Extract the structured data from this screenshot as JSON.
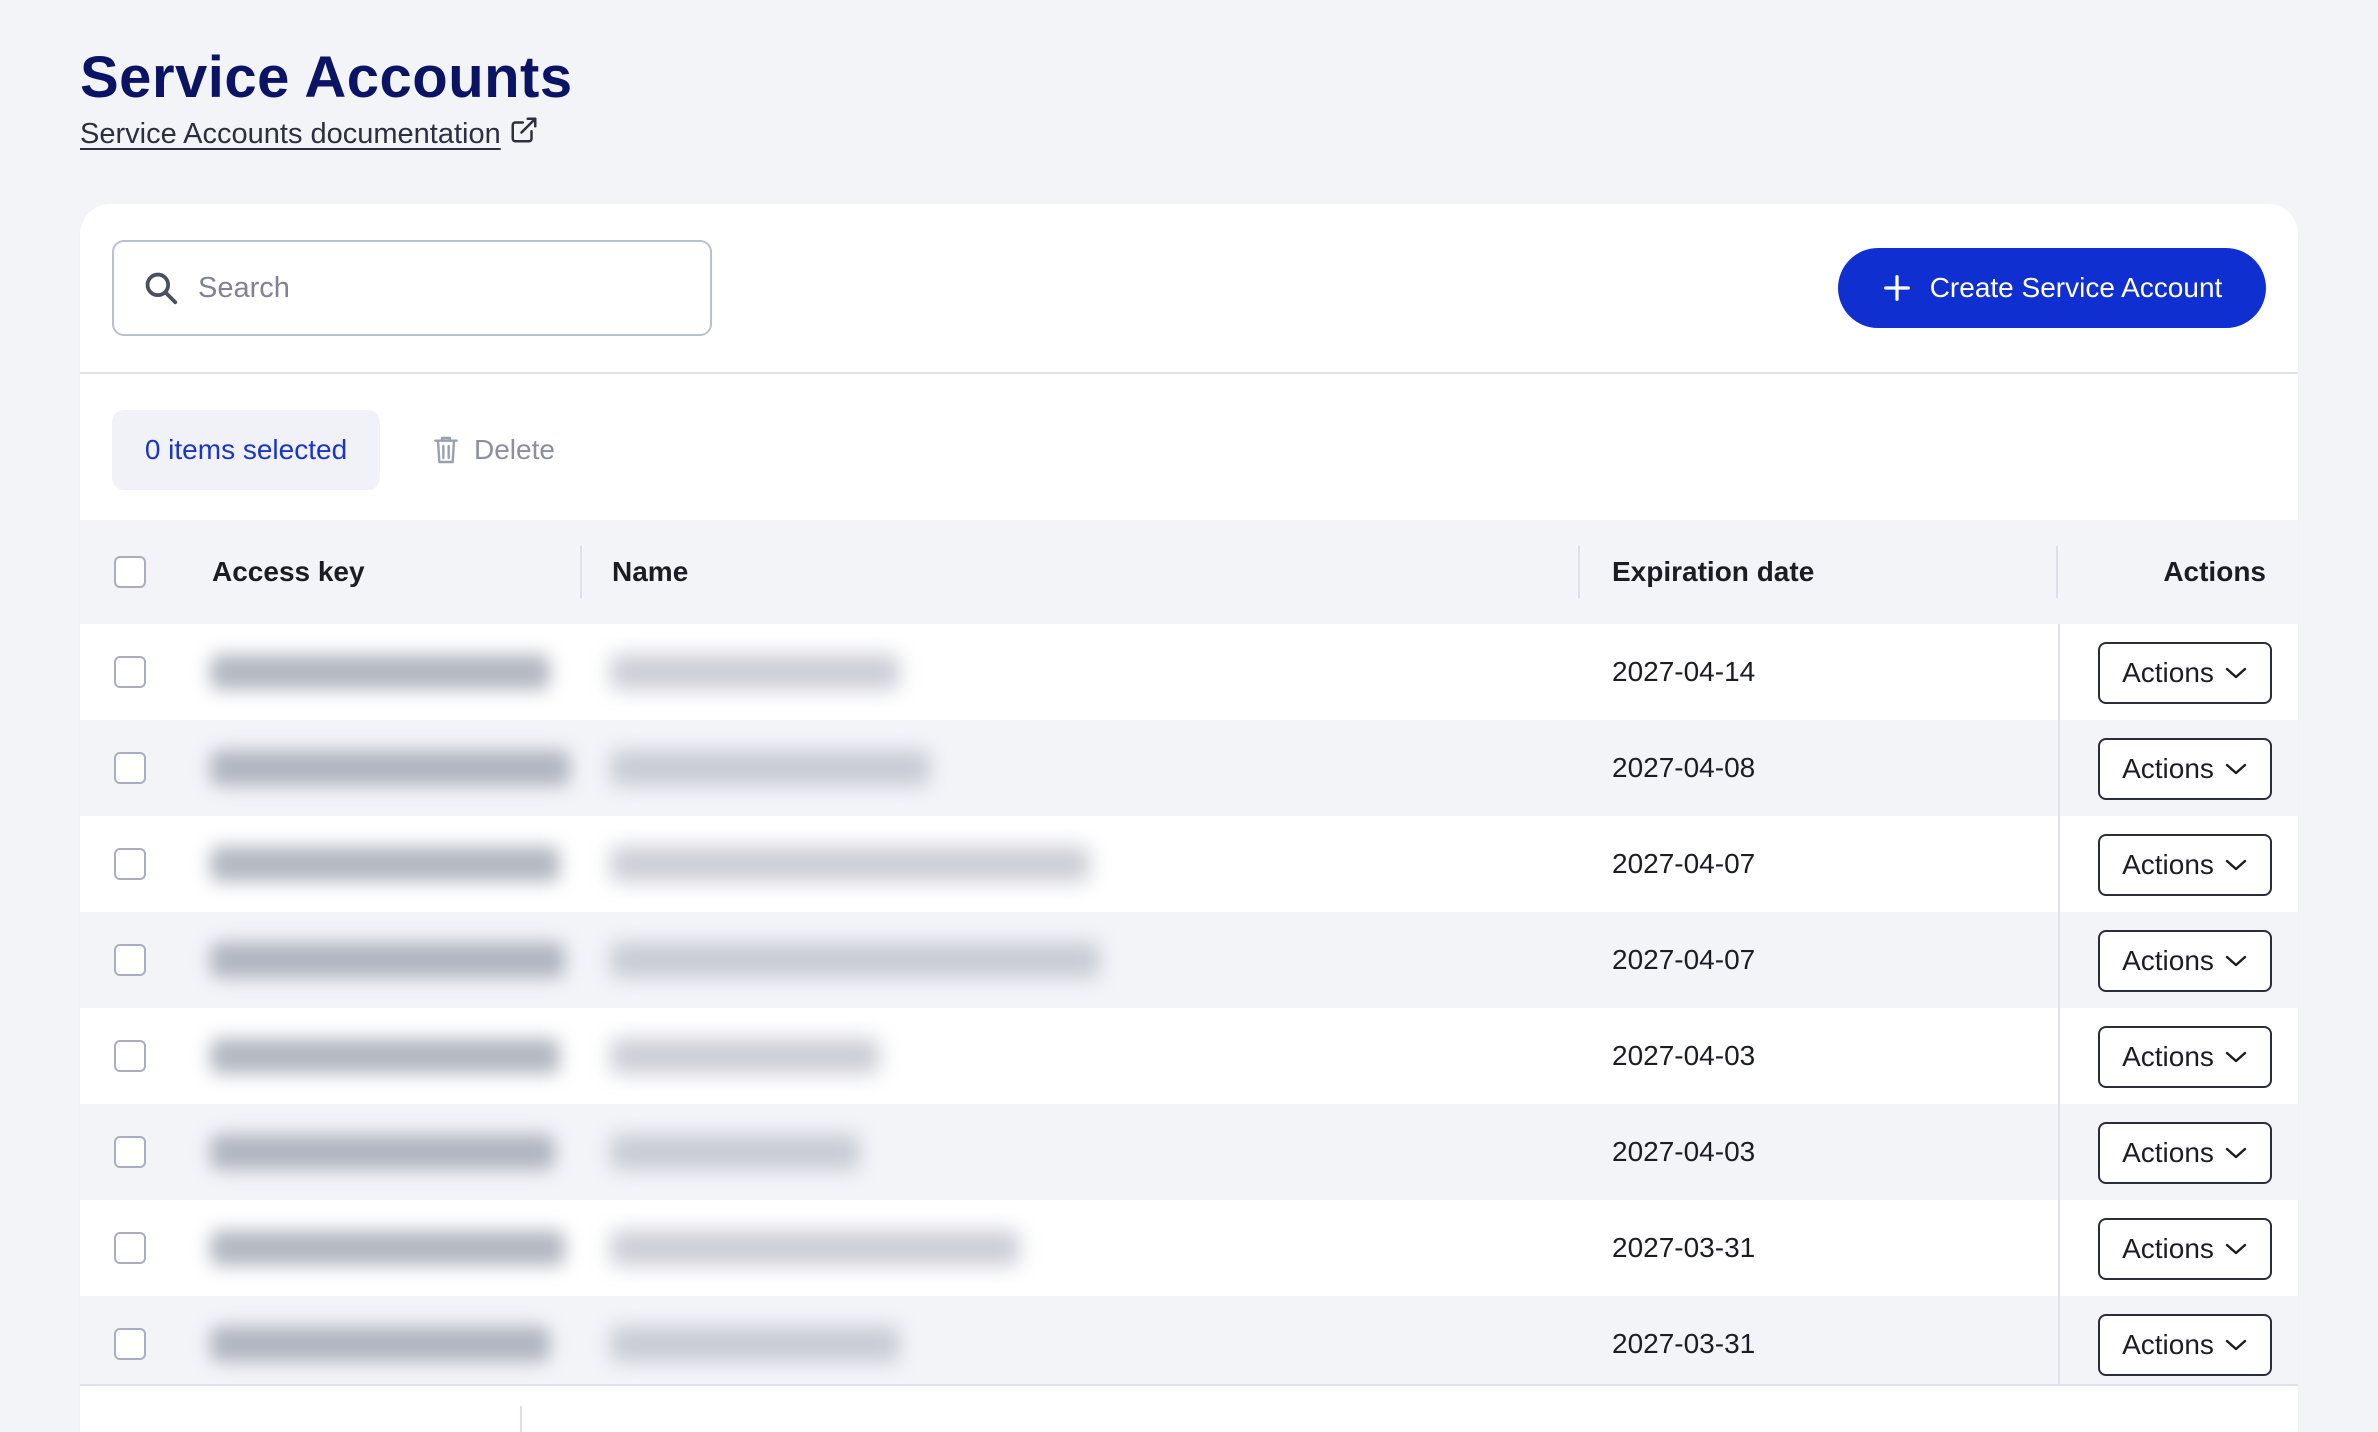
{
  "header": {
    "title": "Service Accounts",
    "doc_link_label": "Service Accounts documentation"
  },
  "toolbar": {
    "search_placeholder": "Search",
    "search_value": "",
    "create_label": "Create Service Account"
  },
  "selection": {
    "selected_label": "0 items selected",
    "delete_label": "Delete"
  },
  "table": {
    "columns": {
      "access_key": "Access key",
      "name": "Name",
      "expiration": "Expiration date",
      "actions": "Actions"
    },
    "rows": [
      {
        "expiration": "2027-04-14",
        "actions_label": "Actions"
      },
      {
        "expiration": "2027-04-08",
        "actions_label": "Actions"
      },
      {
        "expiration": "2027-04-07",
        "actions_label": "Actions"
      },
      {
        "expiration": "2027-04-07",
        "actions_label": "Actions"
      },
      {
        "expiration": "2027-04-03",
        "actions_label": "Actions"
      },
      {
        "expiration": "2027-04-03",
        "actions_label": "Actions"
      },
      {
        "expiration": "2027-03-31",
        "actions_label": "Actions"
      },
      {
        "expiration": "2027-03-31",
        "actions_label": "Actions"
      }
    ]
  },
  "colors": {
    "title": "#0b1364",
    "primary": "#0f2fd0",
    "selected_text": "#1b34c8",
    "background": "#f3f4f8"
  },
  "icons": {
    "doc_link": "external-link-icon",
    "search": "search-icon",
    "create": "plus-icon",
    "delete": "trash-icon",
    "actions": "chevron-down-icon"
  }
}
